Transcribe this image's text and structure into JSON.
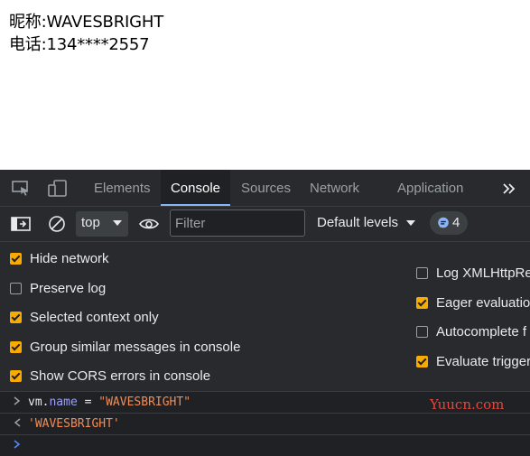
{
  "page": {
    "nickname_line": "昵称:WAVESBRIGHT",
    "phone_line": "电话:134****2557"
  },
  "devtools": {
    "tabs": [
      {
        "label": "Elements"
      },
      {
        "label": "Console"
      },
      {
        "label": "Sources"
      },
      {
        "label": "Network"
      },
      {
        "label": "Application"
      }
    ],
    "toolbar": {
      "context": "top",
      "filter_placeholder": "Filter",
      "levels": "Default levels",
      "issues_count": "4"
    },
    "settings": {
      "left": [
        {
          "label": "Hide network",
          "checked": true
        },
        {
          "label": "Preserve log",
          "checked": false
        },
        {
          "label": "Selected context only",
          "checked": true
        },
        {
          "label": "Group similar messages in console",
          "checked": true
        },
        {
          "label": "Show CORS errors in console",
          "checked": true
        }
      ],
      "right": [
        {
          "label": "Log XMLHttpRe",
          "checked": false
        },
        {
          "label": "Eager evaluatio",
          "checked": true
        },
        {
          "label": "Autocomplete f",
          "checked": false
        },
        {
          "label": "Evaluate trigger",
          "checked": true
        }
      ]
    },
    "console": {
      "input_var": "vm",
      "input_dot": ".",
      "input_prop": "name",
      "input_op": " = ",
      "input_value": "\"WAVESBRIGHT\"",
      "result": "'WAVESBRIGHT'",
      "watermark": "Yuucn.com"
    },
    "colors": {
      "accent_checkbox": "#f9ab00",
      "active_tab_underline": "#8ab4f8",
      "string_color": "#f28b54",
      "watermark_color": "#e8453c"
    }
  }
}
